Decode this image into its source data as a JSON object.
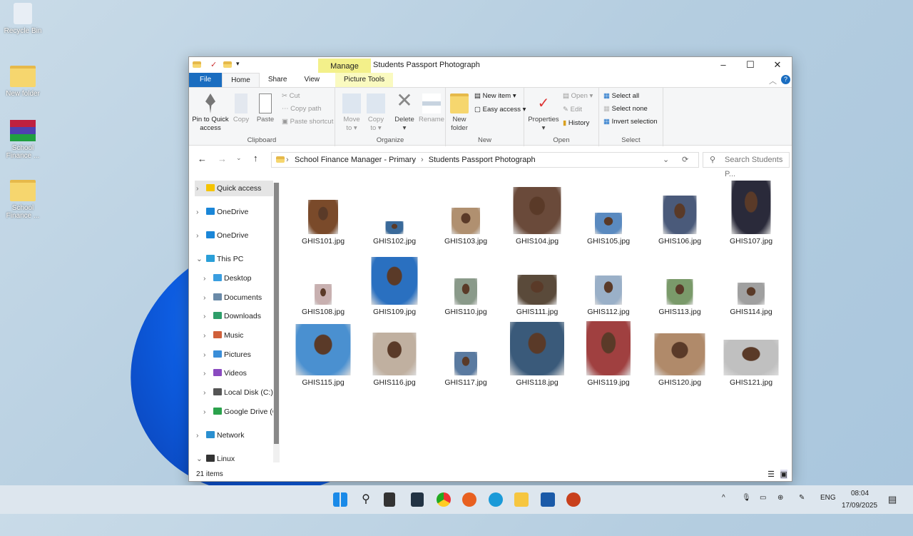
{
  "desktop": [
    {
      "label": "Recycle Bin"
    },
    {
      "label": "New folder"
    },
    {
      "label": "School Finance ..."
    },
    {
      "label": "School Finance ..."
    }
  ],
  "window": {
    "title": "Students Passport Photograph",
    "manage": "Manage",
    "picture_tools": "Picture Tools",
    "tabs": [
      "File",
      "Home",
      "Share",
      "View"
    ],
    "ribbon": {
      "pin": "Pin to Quick access",
      "copy": "Copy",
      "paste": "Paste",
      "cut": "Cut",
      "copy_path": "Copy path",
      "paste_shortcut": "Paste shortcut",
      "clipboard": "Clipboard",
      "move_to": "Move to",
      "copy_to": "Copy to",
      "delete": "Delete",
      "rename": "Rename",
      "organize": "Organize",
      "new_folder": "New folder",
      "new_item": "New item",
      "easy_access": "Easy access",
      "new": "New",
      "properties": "Properties",
      "open": "Open",
      "edit": "Edit",
      "history": "History",
      "open_group": "Open",
      "select_all": "Select all",
      "select_none": "Select none",
      "invert_selection": "Invert selection",
      "select": "Select"
    },
    "breadcrumb": [
      "School Finance Manager - Primary",
      "Students Passport Photograph"
    ],
    "search_placeholder": "Search Students P...",
    "nav": [
      {
        "label": "Quick access",
        "chev": ">",
        "color": "#f5c400",
        "sel": true
      },
      {
        "label": "OneDrive",
        "chev": ">",
        "color": "#1a86d8"
      },
      {
        "label": "OneDrive",
        "chev": ">",
        "color": "#1a86d8"
      },
      {
        "label": "This PC",
        "chev": "v",
        "color": "#2a9fd8"
      },
      {
        "label": "Desktop",
        "chev": ">",
        "color": "#3a9ee0"
      },
      {
        "label": "Documents",
        "chev": ">",
        "color": "#6a8aa8"
      },
      {
        "label": "Downloads",
        "chev": ">",
        "color": "#2e9e6a"
      },
      {
        "label": "Music",
        "chev": ">",
        "color": "#d0603a"
      },
      {
        "label": "Pictures",
        "chev": ">",
        "color": "#3a8ed8"
      },
      {
        "label": "Videos",
        "chev": ">",
        "color": "#8a4ac0"
      },
      {
        "label": "Local Disk (C:)",
        "chev": ">",
        "color": "#555"
      },
      {
        "label": "Google Drive (G",
        "chev": ">",
        "color": "#2ba24c"
      },
      {
        "label": "Network",
        "chev": ">",
        "color": "#2a8fd0"
      },
      {
        "label": "Linux",
        "chev": "v",
        "color": "#333"
      }
    ],
    "files": [
      {
        "name": "GHIS101.jpg",
        "color": "#7a4a2a"
      },
      {
        "name": "GHIS102.jpg",
        "color": "#3a6a9a"
      },
      {
        "name": "GHIS103.jpg",
        "color": "#b09070"
      },
      {
        "name": "GHIS104.jpg",
        "color": "#6a4a3a"
      },
      {
        "name": "GHIS105.jpg",
        "color": "#5a8ac0"
      },
      {
        "name": "GHIS106.jpg",
        "color": "#4a5a7a"
      },
      {
        "name": "GHIS107.jpg",
        "color": "#2a2a3a"
      },
      {
        "name": "GHIS108.jpg",
        "color": "#c8b0b0"
      },
      {
        "name": "GHIS109.jpg",
        "color": "#2a70c0"
      },
      {
        "name": "GHIS110.jpg",
        "color": "#8a9a8a"
      },
      {
        "name": "GHIS111.jpg",
        "color": "#5a4a3a"
      },
      {
        "name": "GHIS112.jpg",
        "color": "#9ab0c8"
      },
      {
        "name": "GHIS113.jpg",
        "color": "#7a9a6a"
      },
      {
        "name": "GHIS114.jpg",
        "color": "#a0a0a0"
      },
      {
        "name": "GHIS115.jpg",
        "color": "#4a90d0"
      },
      {
        "name": "GHIS116.jpg",
        "color": "#c0b0a0"
      },
      {
        "name": "GHIS117.jpg",
        "color": "#5a7aa0"
      },
      {
        "name": "GHIS118.jpg",
        "color": "#3a5a7a"
      },
      {
        "name": "GHIS119.jpg",
        "color": "#a04040"
      },
      {
        "name": "GHIS120.jpg",
        "color": "#b08a6a"
      },
      {
        "name": "GHIS121.jpg",
        "color": "#c0c0c0"
      }
    ],
    "status": "21 items"
  },
  "taskbar": {
    "lang": "ENG",
    "time": "08:04",
    "date": "17/09/2025"
  }
}
